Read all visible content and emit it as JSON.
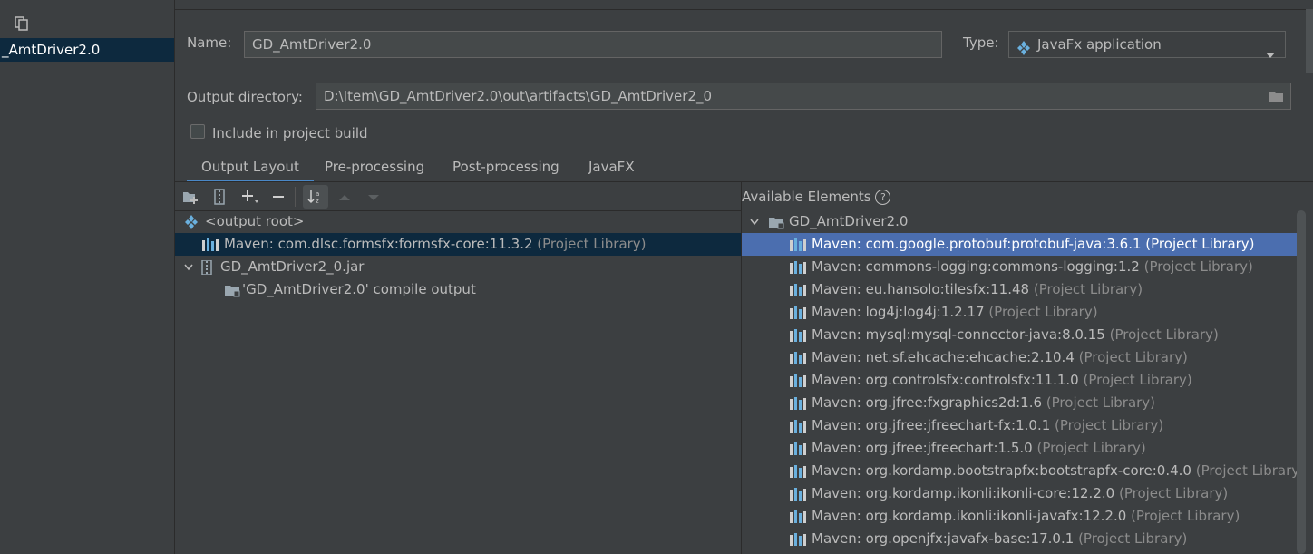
{
  "sidebar": {
    "artifact_item": "_AmtDriver2.0"
  },
  "form": {
    "name_label": "Name:",
    "name_value": "GD_AmtDriver2.0",
    "type_label": "Type:",
    "type_value": "JavaFx application",
    "output_dir_label": "Output directory:",
    "output_dir_value": "D:\\Item\\GD_AmtDriver2.0\\out\\artifacts\\GD_AmtDriver2_0",
    "include_label": "Include in project build"
  },
  "tabs": [
    "Output Layout",
    "Pre-processing",
    "Post-processing",
    "JavaFX"
  ],
  "output_tree": {
    "root": "<output root>",
    "items": [
      {
        "name": "Maven: com.dlsc.formsfx:formsfx-core:11.3.2",
        "suffix": "(Project Library)"
      },
      {
        "name": "GD_AmtDriver2_0.jar",
        "suffix": ""
      },
      {
        "name": "'GD_AmtDriver2.0' compile output",
        "suffix": ""
      }
    ]
  },
  "available": {
    "title": "Available Elements",
    "module": "GD_AmtDriver2.0",
    "suffix": "(Project Library)",
    "items": [
      "Maven: com.google.protobuf:protobuf-java:3.6.1",
      "Maven: commons-logging:commons-logging:1.2",
      "Maven: eu.hansolo:tilesfx:11.48",
      "Maven: log4j:log4j:1.2.17",
      "Maven: mysql:mysql-connector-java:8.0.15",
      "Maven: net.sf.ehcache:ehcache:2.10.4",
      "Maven: org.controlsfx:controlsfx:11.1.0",
      "Maven: org.jfree:fxgraphics2d:1.6",
      "Maven: org.jfree:jfreechart-fx:1.0.1",
      "Maven: org.jfree:jfreechart:1.5.0",
      "Maven: org.kordamp.bootstrapfx:bootstrapfx-core:0.4.0",
      "Maven: org.kordamp.ikonli:ikonli-core:12.2.0",
      "Maven: org.kordamp.ikonli:ikonli-javafx:12.2.0",
      "Maven: org.openjfx:javafx-base:17.0.1"
    ]
  },
  "colors": {
    "background": "#3c3f41",
    "selection_focused": "#4b6eaf",
    "selection_unfocused": "#0d293e",
    "accent_tab": "#4a88c7"
  }
}
